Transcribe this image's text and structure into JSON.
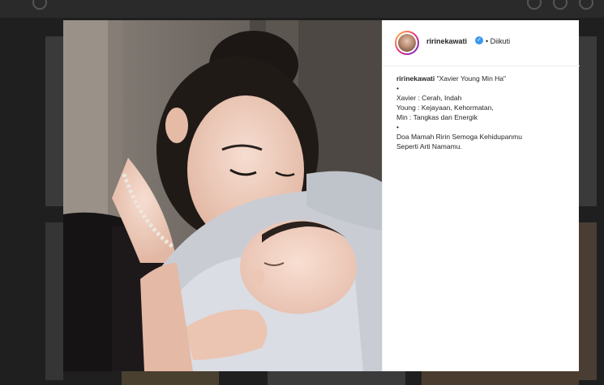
{
  "post": {
    "username": "ririnekawati",
    "follow_status": "• Diikuti",
    "caption_title": "\"Xavier Young Min Ha\"",
    "caption_lines": [
      "•",
      "Xavier : Cerah, Indah",
      "Young : Kejayaan, Kehormatan,",
      "Min : Tangkas dan Energik",
      "•",
      "Doa Mamah Ririn Semoga Kehidupanmu",
      "Seperti Arti Namamu."
    ]
  },
  "icons": {
    "verified": "verified-badge-icon",
    "avatar": "profile-avatar"
  },
  "colors": {
    "verified": "#3897f0",
    "overlay": "#1f1f1f",
    "panel": "#ffffff"
  }
}
